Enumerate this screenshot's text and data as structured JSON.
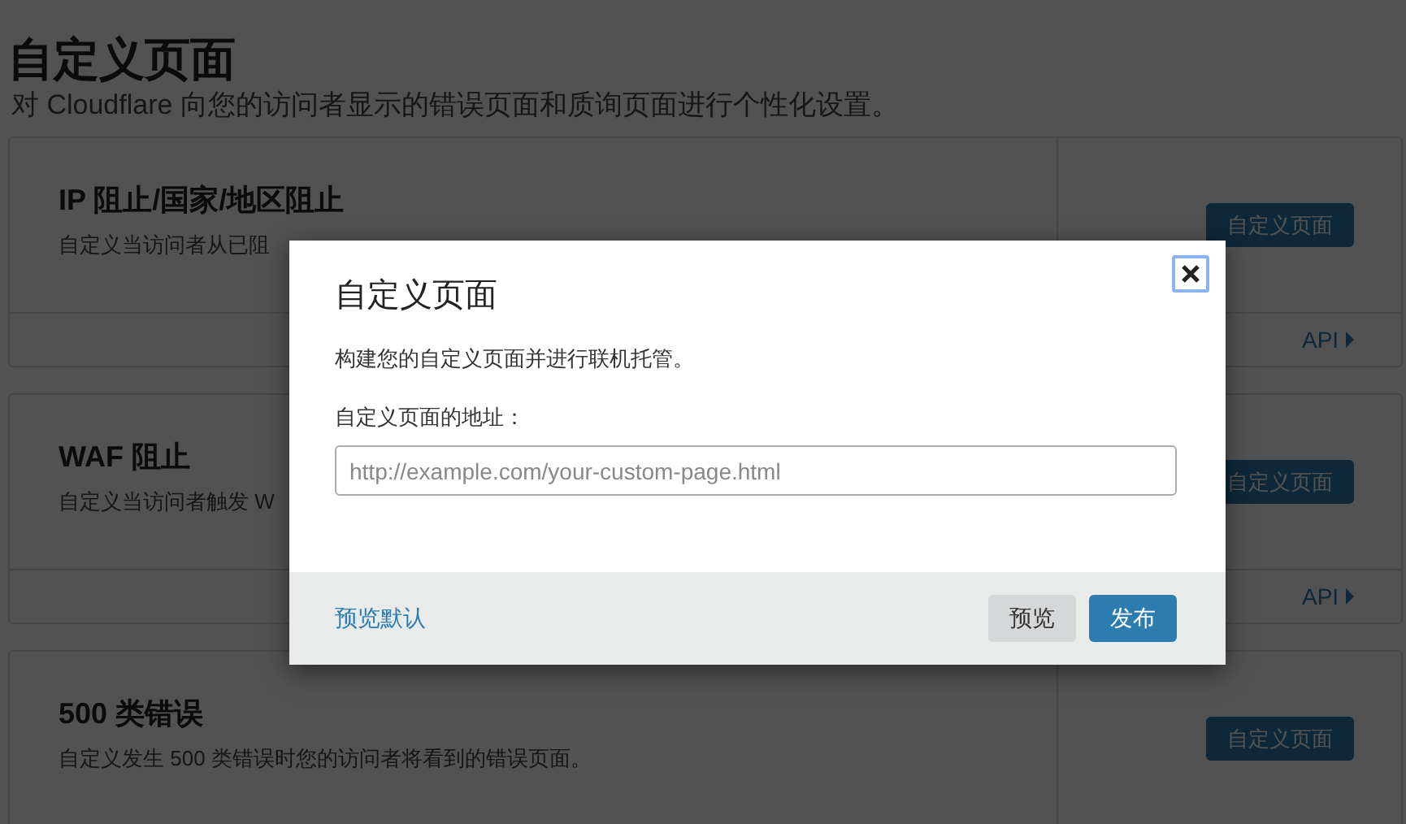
{
  "page": {
    "title": "自定义页面",
    "subtitle": "对 Cloudflare 向您的访问者显示的错误页面和质询页面进行个性化设置。"
  },
  "cards": [
    {
      "title": "IP 阻止/国家/地区阻止",
      "description": "自定义当访问者从已阻",
      "button": "自定义页面",
      "footer_link": "API"
    },
    {
      "title": "WAF 阻止",
      "description": "自定义当访问者触发 W",
      "button": "自定义页面",
      "footer_link": "API"
    },
    {
      "title": "500 类错误",
      "description": "自定义发生 500 类错误时您的访问者将看到的错误页面。",
      "button": "自定义页面"
    }
  ],
  "modal": {
    "title": "自定义页面",
    "body_text": "构建您的自定义页面并进行联机托管。",
    "field_label": "自定义页面的地址：",
    "url_field": {
      "placeholder": "http://example.com/your-custom-page.html"
    },
    "footer_link": "预览默认",
    "buttons": [
      {
        "label": "预览",
        "kind": "secondary"
      },
      {
        "label": "发布",
        "kind": "primary"
      }
    ]
  }
}
